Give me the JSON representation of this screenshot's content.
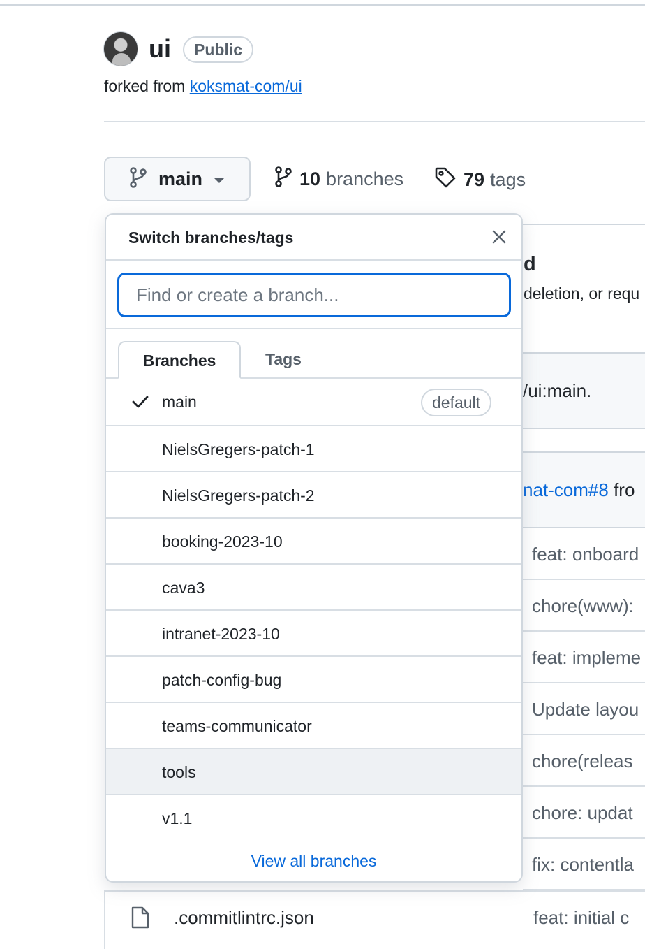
{
  "repo": {
    "name": "ui",
    "visibility": "Public",
    "forked_prefix": "forked from",
    "forked_link": "koksmat-com/ui"
  },
  "branch_selector": {
    "current": "main",
    "branches_count": "10",
    "branches_label": "branches",
    "tags_count": "79",
    "tags_label": "tags"
  },
  "dropdown": {
    "title": "Switch branches/tags",
    "search_placeholder": "Find or create a branch...",
    "tabs": [
      "Branches",
      "Tags"
    ],
    "default_badge": "default",
    "branches": [
      "main",
      "NielsGregers-patch-1",
      "NielsGregers-patch-2",
      "booking-2023-10",
      "cava3",
      "intranet-2023-10",
      "patch-config-bug",
      "teams-communicator",
      "tools",
      "v1.1"
    ],
    "view_all": "View all branches"
  },
  "background": {
    "panel_title": "d",
    "panel_sub": "deletion, or requ",
    "band1_text": "/ui:main.",
    "band2_link": "nat-com#8",
    "band2_rest": " fro",
    "commit_messages": [
      "feat: onboard",
      "chore(www):",
      "feat: impleme",
      "Update layou",
      "chore(releas",
      "chore: updat",
      "fix: contentla"
    ],
    "file_name": ".commitlintrc.json",
    "file_message": "feat: initial c"
  }
}
